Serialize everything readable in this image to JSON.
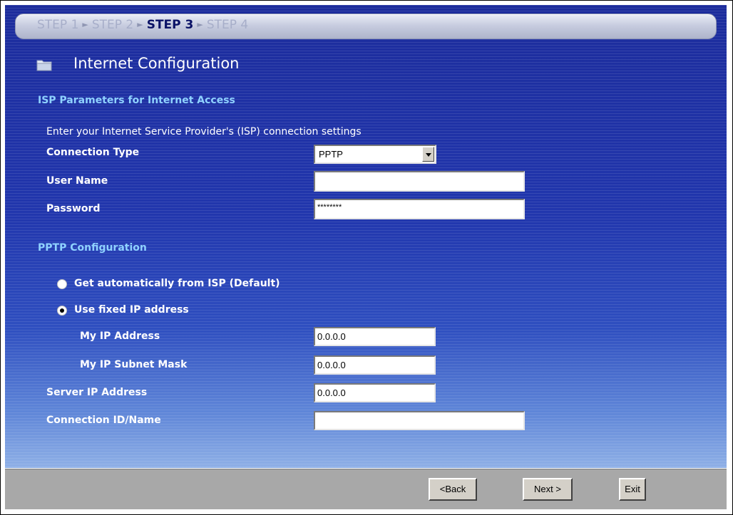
{
  "steps": [
    {
      "label": "STEP 1",
      "active": false
    },
    {
      "label": "STEP 2",
      "active": false
    },
    {
      "label": "STEP 3",
      "active": true
    },
    {
      "label": "STEP 4",
      "active": false
    }
  ],
  "title": "Internet Configuration",
  "isp_section": {
    "heading": "ISP Parameters for Internet Access",
    "instructions": "Enter your Internet Service Provider's (ISP) connection settings",
    "connection_type_label": "Connection Type",
    "connection_type_value": "PPTP",
    "user_name_label": "User Name",
    "user_name_value": "",
    "password_label": "Password",
    "password_value": "********"
  },
  "pptp_section": {
    "heading": "PPTP Configuration",
    "radio_auto_label": "Get automatically from ISP (Default)",
    "radio_auto_selected": false,
    "radio_fixed_label": "Use fixed IP address",
    "radio_fixed_selected": true,
    "my_ip_label": "My IP Address",
    "my_ip_value": "0.0.0.0",
    "subnet_label": "My IP Subnet Mask",
    "subnet_value": "0.0.0.0",
    "server_ip_label": "Server IP Address",
    "server_ip_value": "0.0.0.0",
    "conn_id_label": "Connection ID/Name",
    "conn_id_value": ""
  },
  "buttons": {
    "back": "<Back",
    "next": "Next >",
    "exit": "Exit"
  },
  "colors": {
    "heading": "#8fd2ff",
    "background": "#2438b4",
    "footer": "#a8a8a8"
  }
}
